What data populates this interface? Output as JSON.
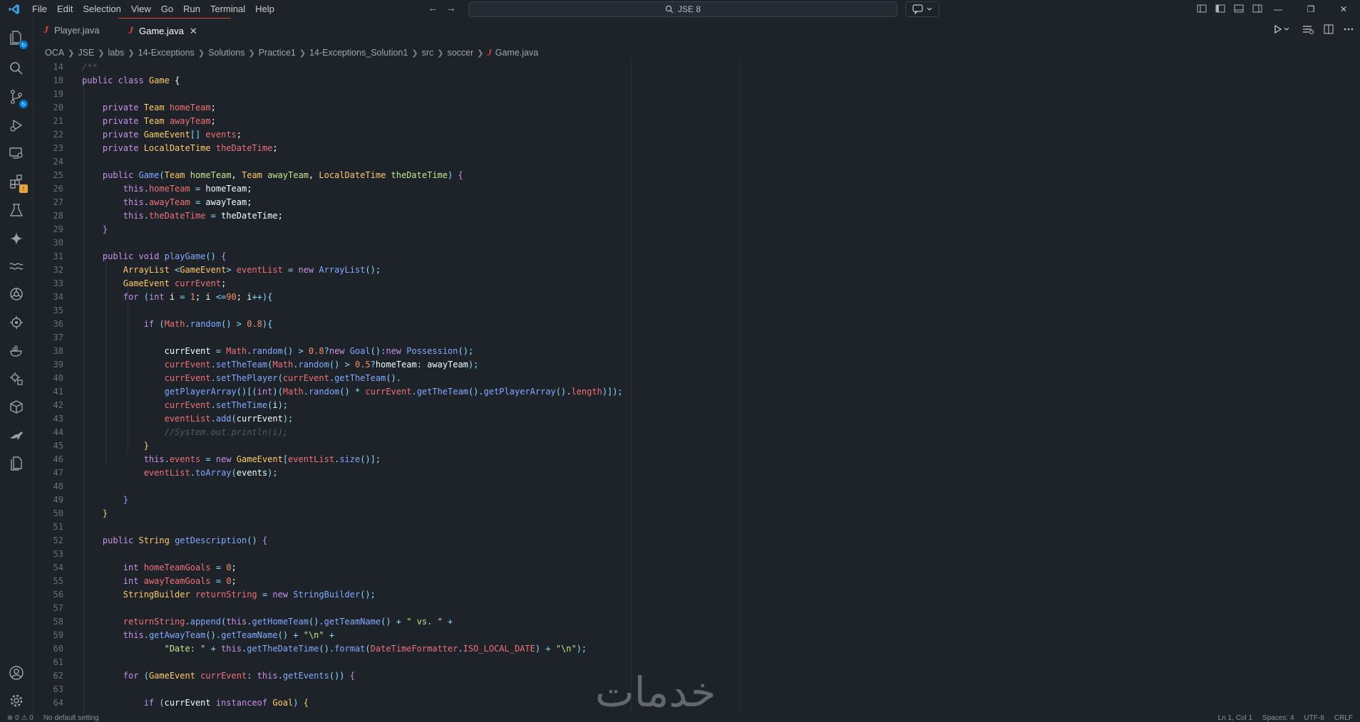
{
  "window": {
    "menus": [
      "File",
      "Edit",
      "Selection",
      "View",
      "Go",
      "Run",
      "Terminal",
      "Help"
    ],
    "search_text": "JSE 8"
  },
  "tabs": [
    {
      "label": "Player.java",
      "active": false
    },
    {
      "label": "Game.java",
      "active": true
    }
  ],
  "breadcrumb": [
    "OCA",
    "JSE",
    "labs",
    "14-Exceptions",
    "Solutions",
    "Practice1",
    "14-Exceptions_Solution1",
    "src",
    "soccer",
    "Game.java"
  ],
  "activity_icons": [
    "explorer-icon",
    "search-icon",
    "source-control-icon",
    "run-debug-icon",
    "remote-explorer-icon",
    "extensions-icon",
    "testing-icon",
    "copilot-icon",
    "wave-icon",
    "gear-wheel-icon",
    "settings-sync-icon",
    "docker-icon",
    "gear-plugin-icon",
    "package-icon",
    "kangaroo-icon",
    "docs-icon",
    "account-icon",
    "manage-gear-icon"
  ],
  "code_lines": [
    {
      "n": "14",
      "t": [
        [
          "cm",
          "/**"
        ]
      ]
    },
    {
      "n": "18",
      "t": [
        [
          "kw",
          "public class "
        ],
        [
          "cls",
          "Game"
        ],
        [
          "pl",
          " {"
        ]
      ]
    },
    {
      "n": "19",
      "t": []
    },
    {
      "n": "20",
      "t": [
        [
          "kw",
          "    private "
        ],
        [
          "cls",
          "Team "
        ],
        [
          "field",
          "homeTeam"
        ],
        [
          "pl",
          ";"
        ]
      ]
    },
    {
      "n": "21",
      "t": [
        [
          "kw",
          "    private "
        ],
        [
          "cls",
          "Team "
        ],
        [
          "field",
          "awayTeam"
        ],
        [
          "pl",
          ";"
        ]
      ]
    },
    {
      "n": "22",
      "t": [
        [
          "kw",
          "    private "
        ],
        [
          "cls",
          "GameEvent"
        ],
        [
          "op",
          "[] "
        ],
        [
          "field",
          "events"
        ],
        [
          "pl",
          ";"
        ]
      ]
    },
    {
      "n": "23",
      "t": [
        [
          "kw",
          "    private "
        ],
        [
          "cls",
          "LocalDateTime "
        ],
        [
          "field",
          "theDateTime"
        ],
        [
          "pl",
          ";"
        ]
      ]
    },
    {
      "n": "24",
      "t": []
    },
    {
      "n": "25",
      "t": [
        [
          "kw",
          "    public "
        ],
        [
          "fn",
          "Game"
        ],
        [
          "op",
          "("
        ],
        [
          "cls",
          "Team "
        ],
        [
          "param",
          "homeTeam"
        ],
        [
          "pl",
          ", "
        ],
        [
          "cls",
          "Team "
        ],
        [
          "param",
          "awayTeam"
        ],
        [
          "pl",
          ", "
        ],
        [
          "cls",
          "LocalDateTime "
        ],
        [
          "param",
          "theDateTime"
        ],
        [
          "op",
          ") "
        ],
        [
          "kw",
          "{"
        ]
      ]
    },
    {
      "n": "26",
      "t": [
        [
          "kw",
          "        this"
        ],
        [
          "op",
          "."
        ],
        [
          "field",
          "homeTeam"
        ],
        [
          "op",
          " = "
        ],
        [
          "pl",
          "homeTeam;"
        ]
      ]
    },
    {
      "n": "27",
      "t": [
        [
          "kw",
          "        this"
        ],
        [
          "op",
          "."
        ],
        [
          "field",
          "awayTeam"
        ],
        [
          "op",
          " = "
        ],
        [
          "pl",
          "awayTeam;"
        ]
      ]
    },
    {
      "n": "28",
      "t": [
        [
          "kw",
          "        this"
        ],
        [
          "op",
          "."
        ],
        [
          "field",
          "theDateTime"
        ],
        [
          "op",
          " = "
        ],
        [
          "pl",
          "theDateTime;"
        ]
      ]
    },
    {
      "n": "29",
      "t": [
        [
          "kw",
          "    }"
        ]
      ]
    },
    {
      "n": "30",
      "t": []
    },
    {
      "n": "31",
      "t": [
        [
          "kw",
          "    public void "
        ],
        [
          "fn",
          "playGame"
        ],
        [
          "op",
          "() "
        ],
        [
          "kw",
          "{"
        ]
      ]
    },
    {
      "n": "32",
      "t": [
        [
          "cls",
          "        ArrayList "
        ],
        [
          "op",
          "<"
        ],
        [
          "cls",
          "GameEvent"
        ],
        [
          "op",
          "> "
        ],
        [
          "field",
          "eventList"
        ],
        [
          "op",
          " = "
        ],
        [
          "kw",
          "new "
        ],
        [
          "fn",
          "ArrayList"
        ],
        [
          "op",
          "();"
        ]
      ]
    },
    {
      "n": "33",
      "t": [
        [
          "cls",
          "        GameEvent "
        ],
        [
          "field",
          "currEvent"
        ],
        [
          "pl",
          ";"
        ]
      ]
    },
    {
      "n": "34",
      "t": [
        [
          "kw",
          "        for "
        ],
        [
          "op",
          "("
        ],
        [
          "kw",
          "int "
        ],
        [
          "pl",
          "i "
        ],
        [
          "op",
          "= "
        ],
        [
          "num",
          "1"
        ],
        [
          "pl",
          "; i "
        ],
        [
          "op",
          "<="
        ],
        [
          "num",
          "90"
        ],
        [
          "pl",
          "; i"
        ],
        [
          "op",
          "++){"
        ]
      ]
    },
    {
      "n": "35",
      "t": []
    },
    {
      "n": "36",
      "t": [
        [
          "kw",
          "            if "
        ],
        [
          "op",
          "("
        ],
        [
          "field",
          "Math"
        ],
        [
          "op",
          "."
        ],
        [
          "fn",
          "random"
        ],
        [
          "op",
          "() > "
        ],
        [
          "num",
          "0.8"
        ],
        [
          "op",
          "){"
        ]
      ]
    },
    {
      "n": "37",
      "t": []
    },
    {
      "n": "38",
      "t": [
        [
          "pl",
          "                currEvent "
        ],
        [
          "op",
          "= "
        ],
        [
          "field",
          "Math"
        ],
        [
          "op",
          "."
        ],
        [
          "fn",
          "random"
        ],
        [
          "op",
          "() > "
        ],
        [
          "num",
          "0.8"
        ],
        [
          "op",
          "?"
        ],
        [
          "kw",
          "new "
        ],
        [
          "fn",
          "Goal"
        ],
        [
          "op",
          "():"
        ],
        [
          "kw",
          "new "
        ],
        [
          "fn",
          "Possession"
        ],
        [
          "op",
          "();"
        ]
      ]
    },
    {
      "n": "39",
      "t": [
        [
          "field",
          "                currEvent"
        ],
        [
          "op",
          "."
        ],
        [
          "fn",
          "setTheTeam"
        ],
        [
          "op",
          "("
        ],
        [
          "field",
          "Math"
        ],
        [
          "op",
          "."
        ],
        [
          "fn",
          "random"
        ],
        [
          "op",
          "() > "
        ],
        [
          "num",
          "0.5"
        ],
        [
          "op",
          "?"
        ],
        [
          "pl",
          "homeTeam"
        ],
        [
          "op",
          ": "
        ],
        [
          "pl",
          "awayTeam"
        ],
        [
          "op",
          ");"
        ]
      ]
    },
    {
      "n": "40",
      "t": [
        [
          "field",
          "                currEvent"
        ],
        [
          "op",
          "."
        ],
        [
          "fn",
          "setThePlayer"
        ],
        [
          "op",
          "("
        ],
        [
          "field",
          "currEvent"
        ],
        [
          "op",
          "."
        ],
        [
          "fn",
          "getTheTeam"
        ],
        [
          "op",
          "()."
        ]
      ]
    },
    {
      "n": "41",
      "t": [
        [
          "fn",
          "                getPlayerArray"
        ],
        [
          "op",
          "()[("
        ],
        [
          "kw",
          "int"
        ],
        [
          "op",
          ")("
        ],
        [
          "field",
          "Math"
        ],
        [
          "op",
          "."
        ],
        [
          "fn",
          "random"
        ],
        [
          "op",
          "() * "
        ],
        [
          "field",
          "currEvent"
        ],
        [
          "op",
          "."
        ],
        [
          "fn",
          "getTheTeam"
        ],
        [
          "op",
          "()."
        ],
        [
          "fn",
          "getPlayerArray"
        ],
        [
          "op",
          "()."
        ],
        [
          "field",
          "length"
        ],
        [
          "op",
          ")]);"
        ]
      ]
    },
    {
      "n": "42",
      "t": [
        [
          "field",
          "                currEvent"
        ],
        [
          "op",
          "."
        ],
        [
          "fn",
          "setTheTime"
        ],
        [
          "op",
          "("
        ],
        [
          "pl",
          "i"
        ],
        [
          "op",
          ");"
        ]
      ]
    },
    {
      "n": "43",
      "t": [
        [
          "field",
          "                eventList"
        ],
        [
          "op",
          "."
        ],
        [
          "fn",
          "add"
        ],
        [
          "op",
          "("
        ],
        [
          "pl",
          "currEvent"
        ],
        [
          "op",
          ");"
        ]
      ]
    },
    {
      "n": "44",
      "t": [
        [
          "cm",
          "                //System.out.println(i);"
        ]
      ]
    },
    {
      "n": "45",
      "t": [
        [
          "cls",
          "            }"
        ]
      ]
    },
    {
      "n": "46",
      "t": [
        [
          "kw",
          "            this"
        ],
        [
          "op",
          "."
        ],
        [
          "field",
          "events"
        ],
        [
          "op",
          " = "
        ],
        [
          "kw",
          "new "
        ],
        [
          "cls",
          "GameEvent"
        ],
        [
          "op",
          "["
        ],
        [
          "field",
          "eventList"
        ],
        [
          "op",
          "."
        ],
        [
          "fn",
          "size"
        ],
        [
          "op",
          "()];"
        ]
      ]
    },
    {
      "n": "47",
      "t": [
        [
          "field",
          "            eventList"
        ],
        [
          "op",
          "."
        ],
        [
          "fn",
          "toArray"
        ],
        [
          "op",
          "("
        ],
        [
          "pl",
          "events"
        ],
        [
          "op",
          ");"
        ]
      ]
    },
    {
      "n": "48",
      "t": []
    },
    {
      "n": "49",
      "t": [
        [
          "ty",
          "        }"
        ]
      ]
    },
    {
      "n": "50",
      "t": [
        [
          "cls",
          "    }"
        ]
      ]
    },
    {
      "n": "51",
      "t": []
    },
    {
      "n": "52",
      "t": [
        [
          "kw",
          "    public "
        ],
        [
          "cls",
          "String "
        ],
        [
          "fn",
          "getDescription"
        ],
        [
          "op",
          "() "
        ],
        [
          "kw",
          "{"
        ]
      ]
    },
    {
      "n": "53",
      "t": []
    },
    {
      "n": "54",
      "t": [
        [
          "kw",
          "        int "
        ],
        [
          "field",
          "homeTeamGoals"
        ],
        [
          "op",
          " = "
        ],
        [
          "num",
          "0"
        ],
        [
          "pl",
          ";"
        ]
      ]
    },
    {
      "n": "55",
      "t": [
        [
          "kw",
          "        int "
        ],
        [
          "field",
          "awayTeamGoals"
        ],
        [
          "op",
          " = "
        ],
        [
          "num",
          "0"
        ],
        [
          "pl",
          ";"
        ]
      ]
    },
    {
      "n": "56",
      "t": [
        [
          "cls",
          "        StringBuilder "
        ],
        [
          "field",
          "returnString"
        ],
        [
          "op",
          " = "
        ],
        [
          "kw",
          "new "
        ],
        [
          "fn",
          "StringBuilder"
        ],
        [
          "op",
          "();"
        ]
      ]
    },
    {
      "n": "57",
      "t": []
    },
    {
      "n": "58",
      "t": [
        [
          "field",
          "        returnString"
        ],
        [
          "op",
          "."
        ],
        [
          "fn",
          "append"
        ],
        [
          "op",
          "("
        ],
        [
          "kw",
          "this"
        ],
        [
          "op",
          "."
        ],
        [
          "fn",
          "getHomeTeam"
        ],
        [
          "op",
          "()."
        ],
        [
          "fn",
          "getTeamName"
        ],
        [
          "op",
          "() + "
        ],
        [
          "str",
          "\" vs. \""
        ],
        [
          "op",
          " +"
        ]
      ]
    },
    {
      "n": "59",
      "t": [
        [
          "kw",
          "        this"
        ],
        [
          "op",
          "."
        ],
        [
          "fn",
          "getAwayTeam"
        ],
        [
          "op",
          "()."
        ],
        [
          "fn",
          "getTeamName"
        ],
        [
          "op",
          "() + "
        ],
        [
          "str",
          "\"\\n\""
        ],
        [
          "op",
          " +"
        ]
      ]
    },
    {
      "n": "60",
      "t": [
        [
          "str",
          "                \"Date: \""
        ],
        [
          "op",
          " + "
        ],
        [
          "kw",
          "this"
        ],
        [
          "op",
          "."
        ],
        [
          "fn",
          "getTheDateTime"
        ],
        [
          "op",
          "()."
        ],
        [
          "fn",
          "format"
        ],
        [
          "op",
          "("
        ],
        [
          "field",
          "DateTimeFormatter"
        ],
        [
          "op",
          "."
        ],
        [
          "field",
          "ISO_LOCAL_DATE"
        ],
        [
          "op",
          ") + "
        ],
        [
          "str",
          "\"\\n\""
        ],
        [
          "op",
          ");"
        ]
      ]
    },
    {
      "n": "61",
      "t": []
    },
    {
      "n": "62",
      "t": [
        [
          "kw",
          "        for "
        ],
        [
          "op",
          "("
        ],
        [
          "cls",
          "GameEvent "
        ],
        [
          "field",
          "currEvent"
        ],
        [
          "op",
          ": "
        ],
        [
          "kw",
          "this"
        ],
        [
          "op",
          "."
        ],
        [
          "fn",
          "getEvents"
        ],
        [
          "op",
          "()) "
        ],
        [
          "kw",
          "{"
        ]
      ]
    },
    {
      "n": "63",
      "t": []
    },
    {
      "n": "64",
      "t": [
        [
          "kw",
          "            if "
        ],
        [
          "op",
          "("
        ],
        [
          "pl",
          "currEvent "
        ],
        [
          "kw",
          "instanceof "
        ],
        [
          "cls",
          "Goal"
        ],
        [
          "op",
          ") "
        ],
        [
          "cls",
          "{"
        ]
      ]
    }
  ],
  "watermark": "خدمات",
  "status": [
    "⊗ 0 ⚠ 0",
    "No default setting",
    "Ln 1, Col 1",
    "Spaces: 4",
    "UTF-8",
    "CRLF"
  ],
  "colors": {
    "accent_tab": "#e2403a",
    "vscode_blue": "#0078d4",
    "warning": "#e8a33d"
  }
}
